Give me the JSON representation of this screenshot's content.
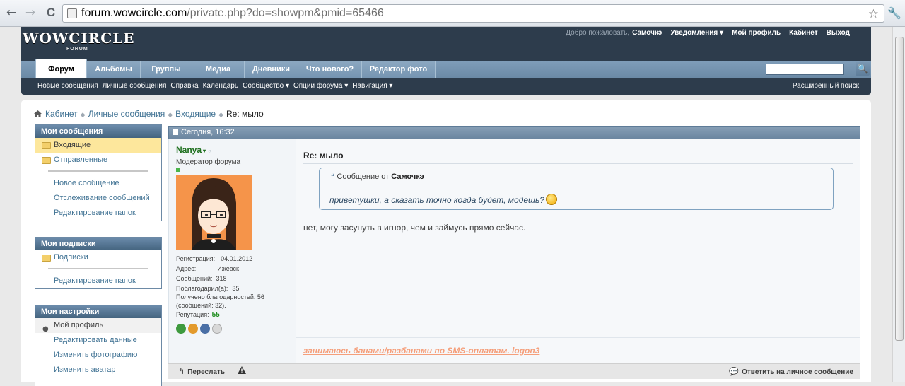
{
  "browser": {
    "back_icon": "←",
    "forward_icon": "→",
    "reload_icon": "C",
    "url_host": "forum.wowcircle.com",
    "url_path": "/private.php?do=showpm&pmid=65466",
    "star_icon": "☆",
    "wrench_icon": "🔧"
  },
  "header": {
    "logo": "WOWCIRCLE",
    "logo_sub": "FORUM",
    "welcome": "Добро пожаловать,",
    "username": "Самочкэ",
    "notifications": "Уведомления ▾",
    "my_profile": "Мой профиль",
    "cabinet": "Кабинет",
    "logout": "Выход"
  },
  "tabs": [
    {
      "label": "Форум",
      "active": true
    },
    {
      "label": "Альбомы"
    },
    {
      "label": "Группы"
    },
    {
      "label": "Медиа"
    },
    {
      "label": "Дневники"
    },
    {
      "label": "Что нового?"
    },
    {
      "label": "Редактор фото"
    }
  ],
  "search": {
    "button": "🔍",
    "advanced": "Расширенный поиск"
  },
  "subnav": [
    "Новые сообщения",
    "Личные сообщения",
    "Справка",
    "Календарь",
    "Сообщество ▾",
    "Опции форума ▾",
    "Навигация ▾"
  ],
  "breadcrumb": {
    "items": [
      "Кабинет",
      "Личные сообщения",
      "Входящие"
    ],
    "current": "Re: мыло",
    "sep": "◆"
  },
  "sidebar": {
    "messages": {
      "title": "Мои сообщения",
      "inbox": "Входящие",
      "sent": "Отправленные",
      "new_message": "Новое сообщение",
      "tracking": "Отслеживание сообщений",
      "edit_folders": "Редактирование папок"
    },
    "subscriptions": {
      "title": "Мои подписки",
      "subscriptions": "Подписки",
      "edit_folders": "Редактирование папок"
    },
    "settings": {
      "title": "Мои настройки",
      "profile": "Мой профиль",
      "edit_data": "Редактировать данные",
      "change_photo": "Изменить фотографию",
      "change_avatar": "Изменить аватар"
    }
  },
  "post": {
    "date": "Сегодня, 16:32",
    "author": "Nanya",
    "author_caret": "▾",
    "author_status": "○",
    "user_title": "Модератор форума",
    "stats": {
      "reg_label": "Регистрация:",
      "reg_value": "04.01.2012",
      "addr_label": "Адрес:",
      "addr_value": "Ижевск",
      "posts_label": "Сообщений:",
      "posts_value": "318",
      "thanked_label": "Поблагодарил(а):",
      "thanked_value": "35",
      "received_line1": "Получено благодарностей: 56",
      "received_line2": "(сообщений: 32).",
      "rep_label": "Репутация:",
      "rep_value": "55"
    },
    "title": "Re: мыло",
    "quote_prefix": "Сообщение от",
    "quote_author": "Самочкэ",
    "quote_text": "приветушки, а сказать точно когда будет, модешь?",
    "text": "нет, могу засунуть в игнор, чем и займусь прямо сейчас.",
    "signature": "занимаюсь банами/разбанами по SMS-оплатам. logon3",
    "forward": "Переслать",
    "reply": "Ответить на личное сообщение"
  },
  "colors": {
    "header_bg": "#2d3c4c",
    "link": "#417394",
    "author": "#1e6f1e",
    "signature": "#f59f7b"
  }
}
